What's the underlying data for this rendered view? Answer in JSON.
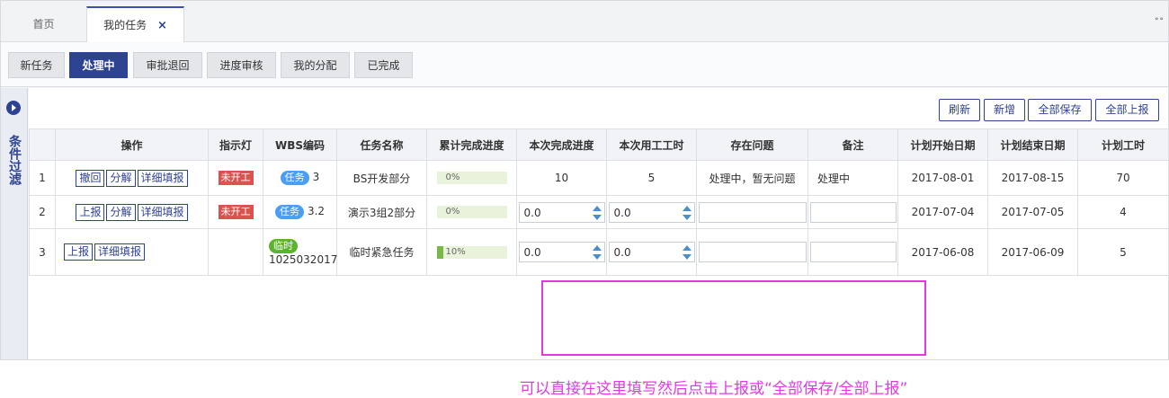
{
  "tabs": [
    {
      "label": "首页"
    },
    {
      "label": "我的任务",
      "close": "×"
    }
  ],
  "overflow_icon": "°°",
  "subtabs": [
    "新任务",
    "处理中",
    "审批退回",
    "进度审核",
    "我的分配",
    "已完成"
  ],
  "active_subtab": "处理中",
  "sidebar": {
    "filter_label": "条件过滤"
  },
  "toolbar": {
    "buttons": [
      "刷新",
      "新增",
      "全部保存",
      "全部上报"
    ]
  },
  "table": {
    "headers": [
      "",
      "操作",
      "指示灯",
      "WBS编码",
      "任务名称",
      "累计完成进度",
      "本次完成进度",
      "本次用工工时",
      "存在问题",
      "备注",
      "计划开始日期",
      "计划结束日期",
      "计划工时"
    ],
    "rows": [
      {
        "index": "1",
        "ops": [
          "撤回",
          "分解",
          "详细填报"
        ],
        "lamp": "未开工",
        "wbs_tag": "任务",
        "wbs_code": "3",
        "name": "BS开发部分",
        "progress_pct": 0,
        "progress_label": "0%",
        "this_progress": "10",
        "this_hours": "5",
        "issue": "处理中，暂无问题",
        "remark": "处理中",
        "start": "2017-08-01",
        "end": "2017-08-15",
        "planned_hours": "70"
      },
      {
        "index": "2",
        "ops": [
          "上报",
          "分解",
          "详细填报"
        ],
        "lamp": "未开工",
        "wbs_tag": "任务",
        "wbs_code": "3.2",
        "name": "演示3组2部分",
        "progress_pct": 0,
        "progress_label": "0%",
        "this_progress": "0.0",
        "this_hours": "0.0",
        "issue": "",
        "remark": "",
        "start": "2017-07-04",
        "end": "2017-07-05",
        "planned_hours": "4"
      },
      {
        "index": "3",
        "ops": [
          "上报",
          "详细填报"
        ],
        "lamp": "",
        "wbs_tag": "临时",
        "wbs_code": "1025032017",
        "name": "临时紧急任务",
        "progress_pct": 10,
        "progress_label": "10%",
        "this_progress": "0.0",
        "this_hours": "0.0",
        "issue": "",
        "remark": "",
        "start": "2017-06-08",
        "end": "2017-06-09",
        "planned_hours": "5"
      }
    ]
  },
  "annotation": "可以直接在这里填写然后点击上报或“全部保存/全部上报”",
  "colors": {
    "primary": "#2e4292",
    "lamp_red": "#d9534f",
    "pill_blue": "#4a9ff5",
    "pill_green": "#5bb42c",
    "annotation": "#e13be0"
  }
}
